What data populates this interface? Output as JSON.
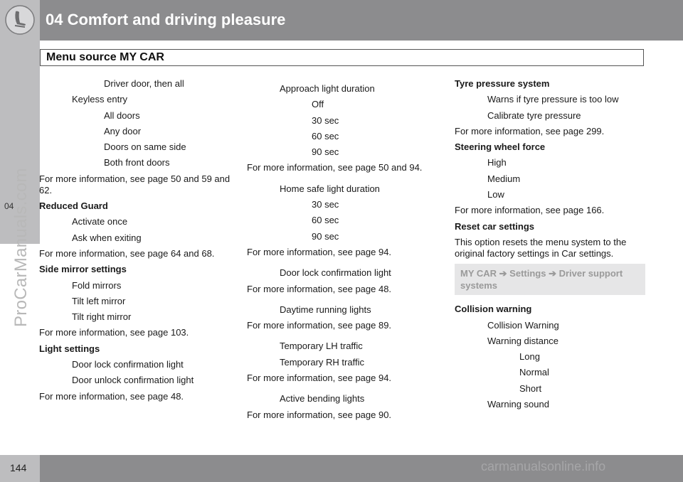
{
  "header": {
    "chapter_title": "04 Comfort and driving pleasure",
    "icon": "seat-icon",
    "side_tab": "04"
  },
  "section": {
    "title": "Menu source MY CAR"
  },
  "watermark": "ProCarManuals.com",
  "footer": {
    "page_number": "144",
    "watermark": "carmanualsonline.info"
  },
  "columns": [
    [
      {
        "text": "Driver door, then all",
        "indent": 2
      },
      {
        "text": "Keyless entry",
        "indent": 1
      },
      {
        "text": "All doors",
        "indent": 2
      },
      {
        "text": "Any door",
        "indent": 2
      },
      {
        "text": "Doors on same side",
        "indent": 2
      },
      {
        "text": "Both front doors",
        "indent": 2
      },
      {
        "text": "For more information, see page 50 and 59 and 62.",
        "indent": 0
      },
      {
        "text": "Reduced Guard",
        "indent": 0,
        "bold": true
      },
      {
        "text": "Activate once",
        "indent": 1
      },
      {
        "text": "Ask when exiting",
        "indent": 1
      },
      {
        "text": "For more information, see page 64 and 68.",
        "indent": 0
      },
      {
        "text": "Side mirror settings",
        "indent": 0,
        "bold": true
      },
      {
        "text": "Fold mirrors",
        "indent": 1
      },
      {
        "text": "Tilt left mirror",
        "indent": 1
      },
      {
        "text": "Tilt right mirror",
        "indent": 1
      },
      {
        "text": "For more information, see page 103.",
        "indent": 0
      },
      {
        "text": "Light settings",
        "indent": 0,
        "bold": true
      },
      {
        "text": "Door lock confirmation light",
        "indent": 1
      },
      {
        "text": "Door unlock confirmation light",
        "indent": 1
      },
      {
        "text": "For more information, see page 48.",
        "indent": 0
      }
    ],
    [
      {
        "text": "Approach light duration",
        "indent": 1,
        "gap_before": true
      },
      {
        "text": "Off",
        "indent": 2
      },
      {
        "text": "30 sec",
        "indent": 2
      },
      {
        "text": "60 sec",
        "indent": 2
      },
      {
        "text": "90 sec",
        "indent": 2
      },
      {
        "text": "For more information, see page 50 and 94.",
        "indent": 0
      },
      {
        "text": "Home safe light duration",
        "indent": 1,
        "gap_before": true
      },
      {
        "text": "30 sec",
        "indent": 2
      },
      {
        "text": "60 sec",
        "indent": 2
      },
      {
        "text": "90 sec",
        "indent": 2
      },
      {
        "text": "For more information, see page 94.",
        "indent": 0
      },
      {
        "text": "Door lock confirmation light",
        "indent": 1,
        "gap_before": true
      },
      {
        "text": "For more information, see page 48.",
        "indent": 0
      },
      {
        "text": "Daytime running lights",
        "indent": 1,
        "gap_before": true
      },
      {
        "text": "For more information, see page 89.",
        "indent": 0
      },
      {
        "text": "Temporary LH traffic",
        "indent": 1,
        "gap_before": true
      },
      {
        "text": "Temporary RH traffic",
        "indent": 1
      },
      {
        "text": "For more information, see page 94.",
        "indent": 0
      },
      {
        "text": "Active bending lights",
        "indent": 1,
        "gap_before": true
      },
      {
        "text": "For more information, see page 90.",
        "indent": 0
      }
    ],
    [
      {
        "text": "Tyre pressure system",
        "indent": 0,
        "bold": true
      },
      {
        "text": "Warns if tyre pressure is too low",
        "indent": 1
      },
      {
        "text": "Calibrate tyre pressure",
        "indent": 1
      },
      {
        "text": "For more information, see page 299.",
        "indent": 0
      },
      {
        "text": "Steering wheel force",
        "indent": 0,
        "bold": true
      },
      {
        "text": "High",
        "indent": 1
      },
      {
        "text": "Medium",
        "indent": 1
      },
      {
        "text": "Low",
        "indent": 1
      },
      {
        "text": "For more information, see page 166.",
        "indent": 0
      },
      {
        "text": "Reset car settings",
        "indent": 0,
        "bold": true
      },
      {
        "text": "This option resets the menu system to the original factory settings in Car settings.",
        "indent": 0,
        "display": "This option resets the menu system to the orig- inal factory settings in Car settings."
      },
      {
        "menu_path": [
          "MY CAR",
          "Settings",
          "Driver support systems"
        ],
        "arrow": "➔"
      },
      {
        "text": "Collision warning",
        "indent": 0,
        "bold": true
      },
      {
        "text": "Collision Warning",
        "indent": 1
      },
      {
        "text": "Warning distance",
        "indent": 1
      },
      {
        "text": "Long",
        "indent": 2
      },
      {
        "text": "Normal",
        "indent": 2
      },
      {
        "text": "Short",
        "indent": 2
      },
      {
        "text": "Warning sound",
        "indent": 1
      }
    ]
  ]
}
